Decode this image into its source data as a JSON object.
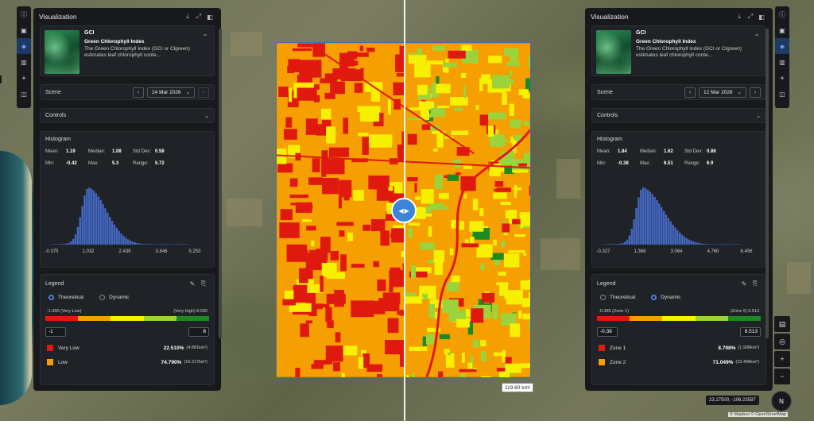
{
  "colors": {
    "very_low": "#e0190f",
    "low": "#f5a000",
    "mid": "#f7f000",
    "high": "#9cd33a",
    "very_high": "#1b8a22",
    "accent": "#3c85d6",
    "panel_bg": "#17191c"
  },
  "left_sidebar": {
    "items": [
      {
        "icon": "info-icon"
      },
      {
        "icon": "image-icon"
      },
      {
        "icon": "layers-icon"
      },
      {
        "icon": "chart-icon"
      },
      {
        "icon": "share-icon"
      },
      {
        "icon": "split-view-icon"
      }
    ]
  },
  "right_sidebar": {
    "items": [
      {
        "icon": "info-icon"
      },
      {
        "icon": "image-icon"
      },
      {
        "icon": "layers-icon"
      },
      {
        "icon": "chart-icon"
      },
      {
        "icon": "share-icon"
      },
      {
        "icon": "split-view-icon"
      }
    ]
  },
  "left_panel": {
    "title": "Visualization",
    "index": {
      "short": "GCI",
      "full": "Green Chlorophyll Index",
      "desc": "The Green Chlorophyll Index (GCI or Clgreen) estimates leaf chlorophyll conte..."
    },
    "scene": {
      "label": "Scene",
      "date": "24 Mar 2026"
    },
    "controls": {
      "label": "Controls"
    },
    "histogram": {
      "title": "Histogram",
      "mean_label": "Mean:",
      "mean": "1.19",
      "median_label": "Median:",
      "median": "1.08",
      "std_label": "Std Dev:",
      "std": "0.58",
      "min_label": "Min:",
      "min": "-0.42",
      "max_label": "Max:",
      "max": "5.3",
      "range_label": "Range:",
      "range": "5.72",
      "ticks": [
        "-0.375",
        "1.032",
        "2.439",
        "3.846",
        "5.253"
      ]
    },
    "legend": {
      "title": "Legend",
      "opt_theoretical": "Theoretical",
      "opt_dynamic": "Dynamic",
      "selected": "Theoretical",
      "range_min": "-1.000 (Very Low)",
      "range_max": "(Very High) 8.000",
      "input_min": "-1",
      "input_max": "8",
      "zones": [
        {
          "name": "Very Low",
          "pct": "22.510%",
          "area": "(4.881km²)",
          "color": "#e0190f"
        },
        {
          "name": "Low",
          "pct": "74.790%",
          "area": "(16.217km²)",
          "color": "#f5a000"
        }
      ]
    }
  },
  "right_panel": {
    "title": "Visualization",
    "index": {
      "short": "GCI",
      "full": "Green Chlorophyll Index",
      "desc": "The Green Chlorophyll Index (GCI or Clgreen) estimates leaf chlorophyll conte..."
    },
    "scene": {
      "label": "Scene",
      "date": "12 Mar 2026"
    },
    "controls": {
      "label": "Controls"
    },
    "histogram": {
      "title": "Histogram",
      "mean_label": "Mean:",
      "mean": "1.84",
      "median_label": "Median:",
      "median": "1.62",
      "std_label": "Std Dev:",
      "std": "0.86",
      "min_label": "Min:",
      "min": "-0.38",
      "max_label": "Max:",
      "max": "6.51",
      "range_label": "Range:",
      "range": "6.9",
      "ticks": [
        "-0.327",
        "1.368",
        "3.064",
        "4.760",
        "6.456"
      ]
    },
    "legend": {
      "title": "Legend",
      "opt_theoretical": "Theoretical",
      "opt_dynamic": "Dynamic",
      "selected": "Dynamic",
      "range_min": "-0.385 (Zone 1)",
      "range_max": "(Zone 5) 6.513",
      "input_min": "-0.38",
      "input_max": "6.513",
      "zones": [
        {
          "name": "Zone 1",
          "pct": "8.798%",
          "area": "(1.908km²)",
          "color": "#e0190f"
        },
        {
          "name": "Zone 2",
          "pct": "71.049%",
          "area": "(15.406km²)",
          "color": "#f5a000"
        }
      ]
    }
  },
  "map": {
    "area_label": "119.60 km²",
    "coords": "23.17500, -106.23587",
    "attribution": "© Mapbox © OpenStreetMap",
    "compass": "N"
  },
  "map_controls": [
    {
      "icon": "map-style-icon"
    },
    {
      "icon": "locate-icon"
    },
    {
      "icon": "zoom-in-icon",
      "label": "+"
    },
    {
      "icon": "zoom-out-icon",
      "label": "−"
    }
  ]
}
